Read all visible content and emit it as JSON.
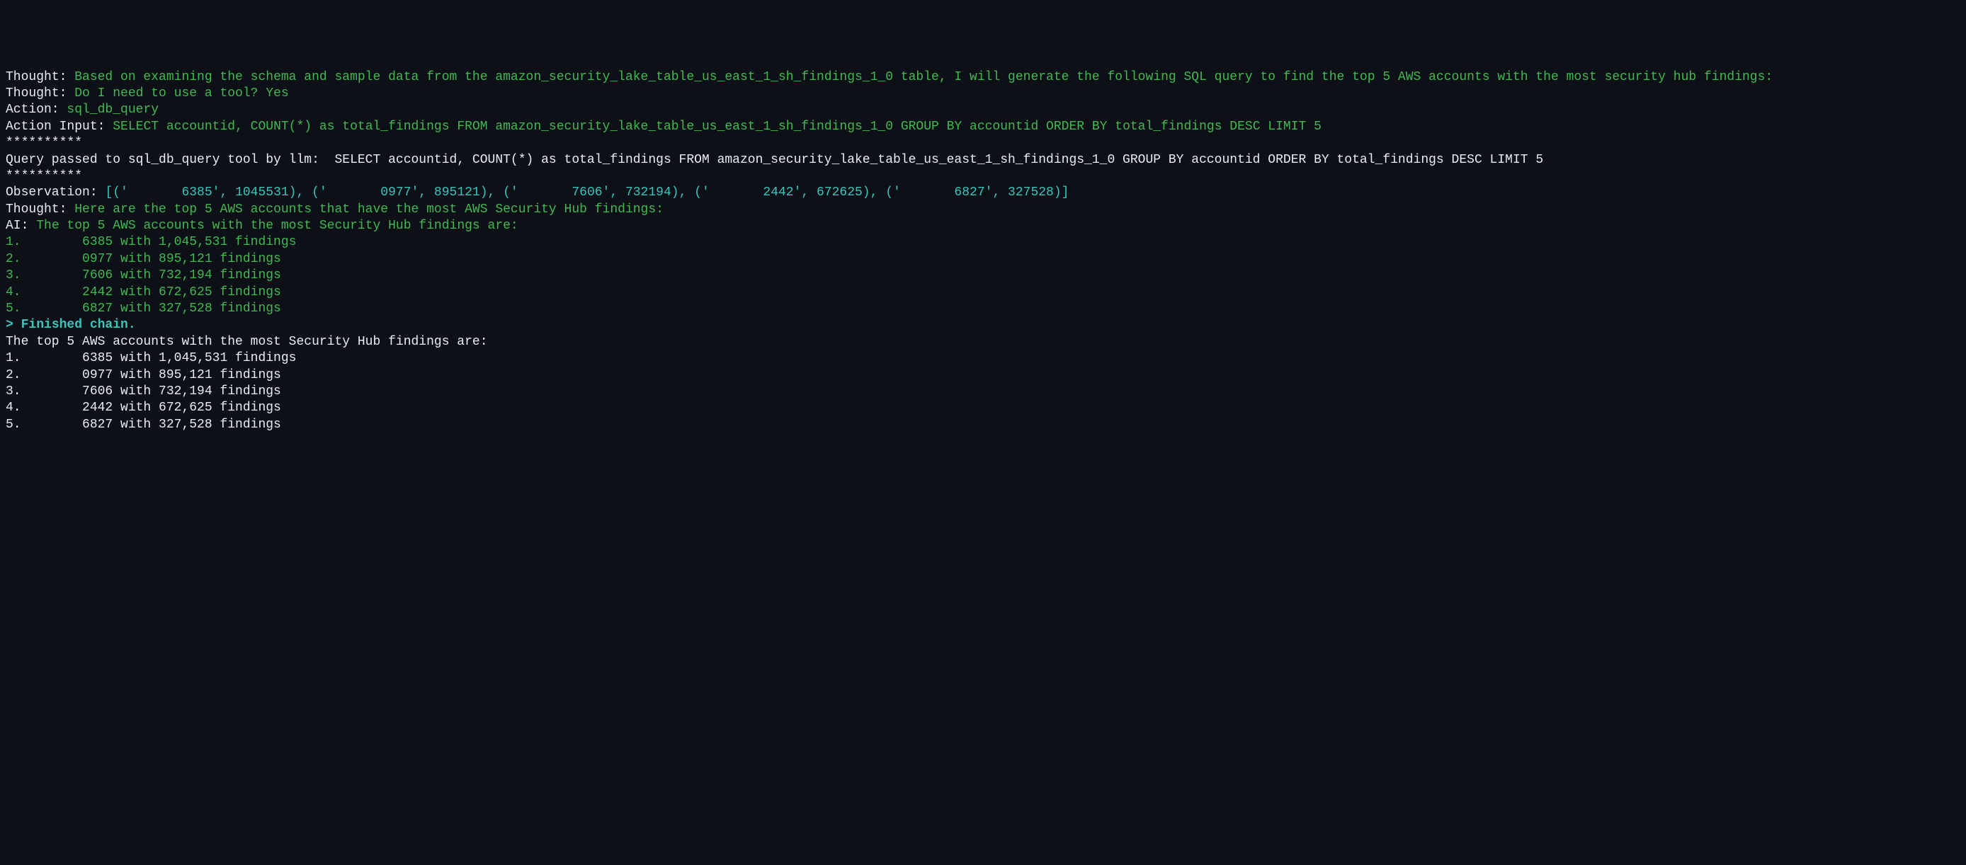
{
  "lines": {
    "thought1_label": "Thought: ",
    "thought1_text": "Based on examining the schema and sample data from the amazon_security_lake_table_us_east_1_sh_findings_1_0 table, I will generate the following SQL query to find the top 5 AWS accounts with the most security hub findings:",
    "blank1": "",
    "thought2_label": "Thought: ",
    "thought2_text": "Do I need to use a tool? Yes",
    "action_label": "Action: ",
    "action_text": "sql_db_query",
    "action_input_label": "Action Input: ",
    "action_input_text": "SELECT accountid, COUNT(*) as total_findings FROM amazon_security_lake_table_us_east_1_sh_findings_1_0 GROUP BY accountid ORDER BY total_findings DESC LIMIT 5",
    "stars1": "**********",
    "query_passed": "Query passed to sql_db_query tool by llm:  SELECT accountid, COUNT(*) as total_findings FROM amazon_security_lake_table_us_east_1_sh_findings_1_0 GROUP BY accountid ORDER BY total_findings DESC LIMIT 5",
    "stars2": "**********",
    "blank2": "",
    "blank3": "",
    "observation_label": "Observation: ",
    "observation_text": "[('       6385', 1045531), ('       0977', 895121), ('       7606', 732194), ('       2442', 672625), ('       6827', 327528)]",
    "thought3_label": "Thought: ",
    "thought3_text": "Here are the top 5 AWS accounts that have the most AWS Security Hub findings:",
    "blank4": "",
    "ai_label": "AI: ",
    "ai_text": "The top 5 AWS accounts with the most Security Hub findings are:",
    "blank5": "",
    "result1": "1.        6385 with 1,045,531 findings",
    "result2": "2.        0977 with 895,121 findings",
    "result3": "3.        7606 with 732,194 findings",
    "result4": "4.        2442 with 672,625 findings",
    "result5": "5.        6827 with 327,528 findings",
    "blank6": "",
    "finished_marker": "> ",
    "finished_text": "Finished chain.",
    "final_intro": "The top 5 AWS accounts with the most Security Hub findings are:",
    "blank7": "",
    "final1": "1.        6385 with 1,045,531 findings",
    "final2": "2.        0977 with 895,121 findings",
    "final3": "3.        7606 with 732,194 findings",
    "final4": "4.        2442 with 672,625 findings",
    "final5": "5.        6827 with 327,528 findings"
  }
}
